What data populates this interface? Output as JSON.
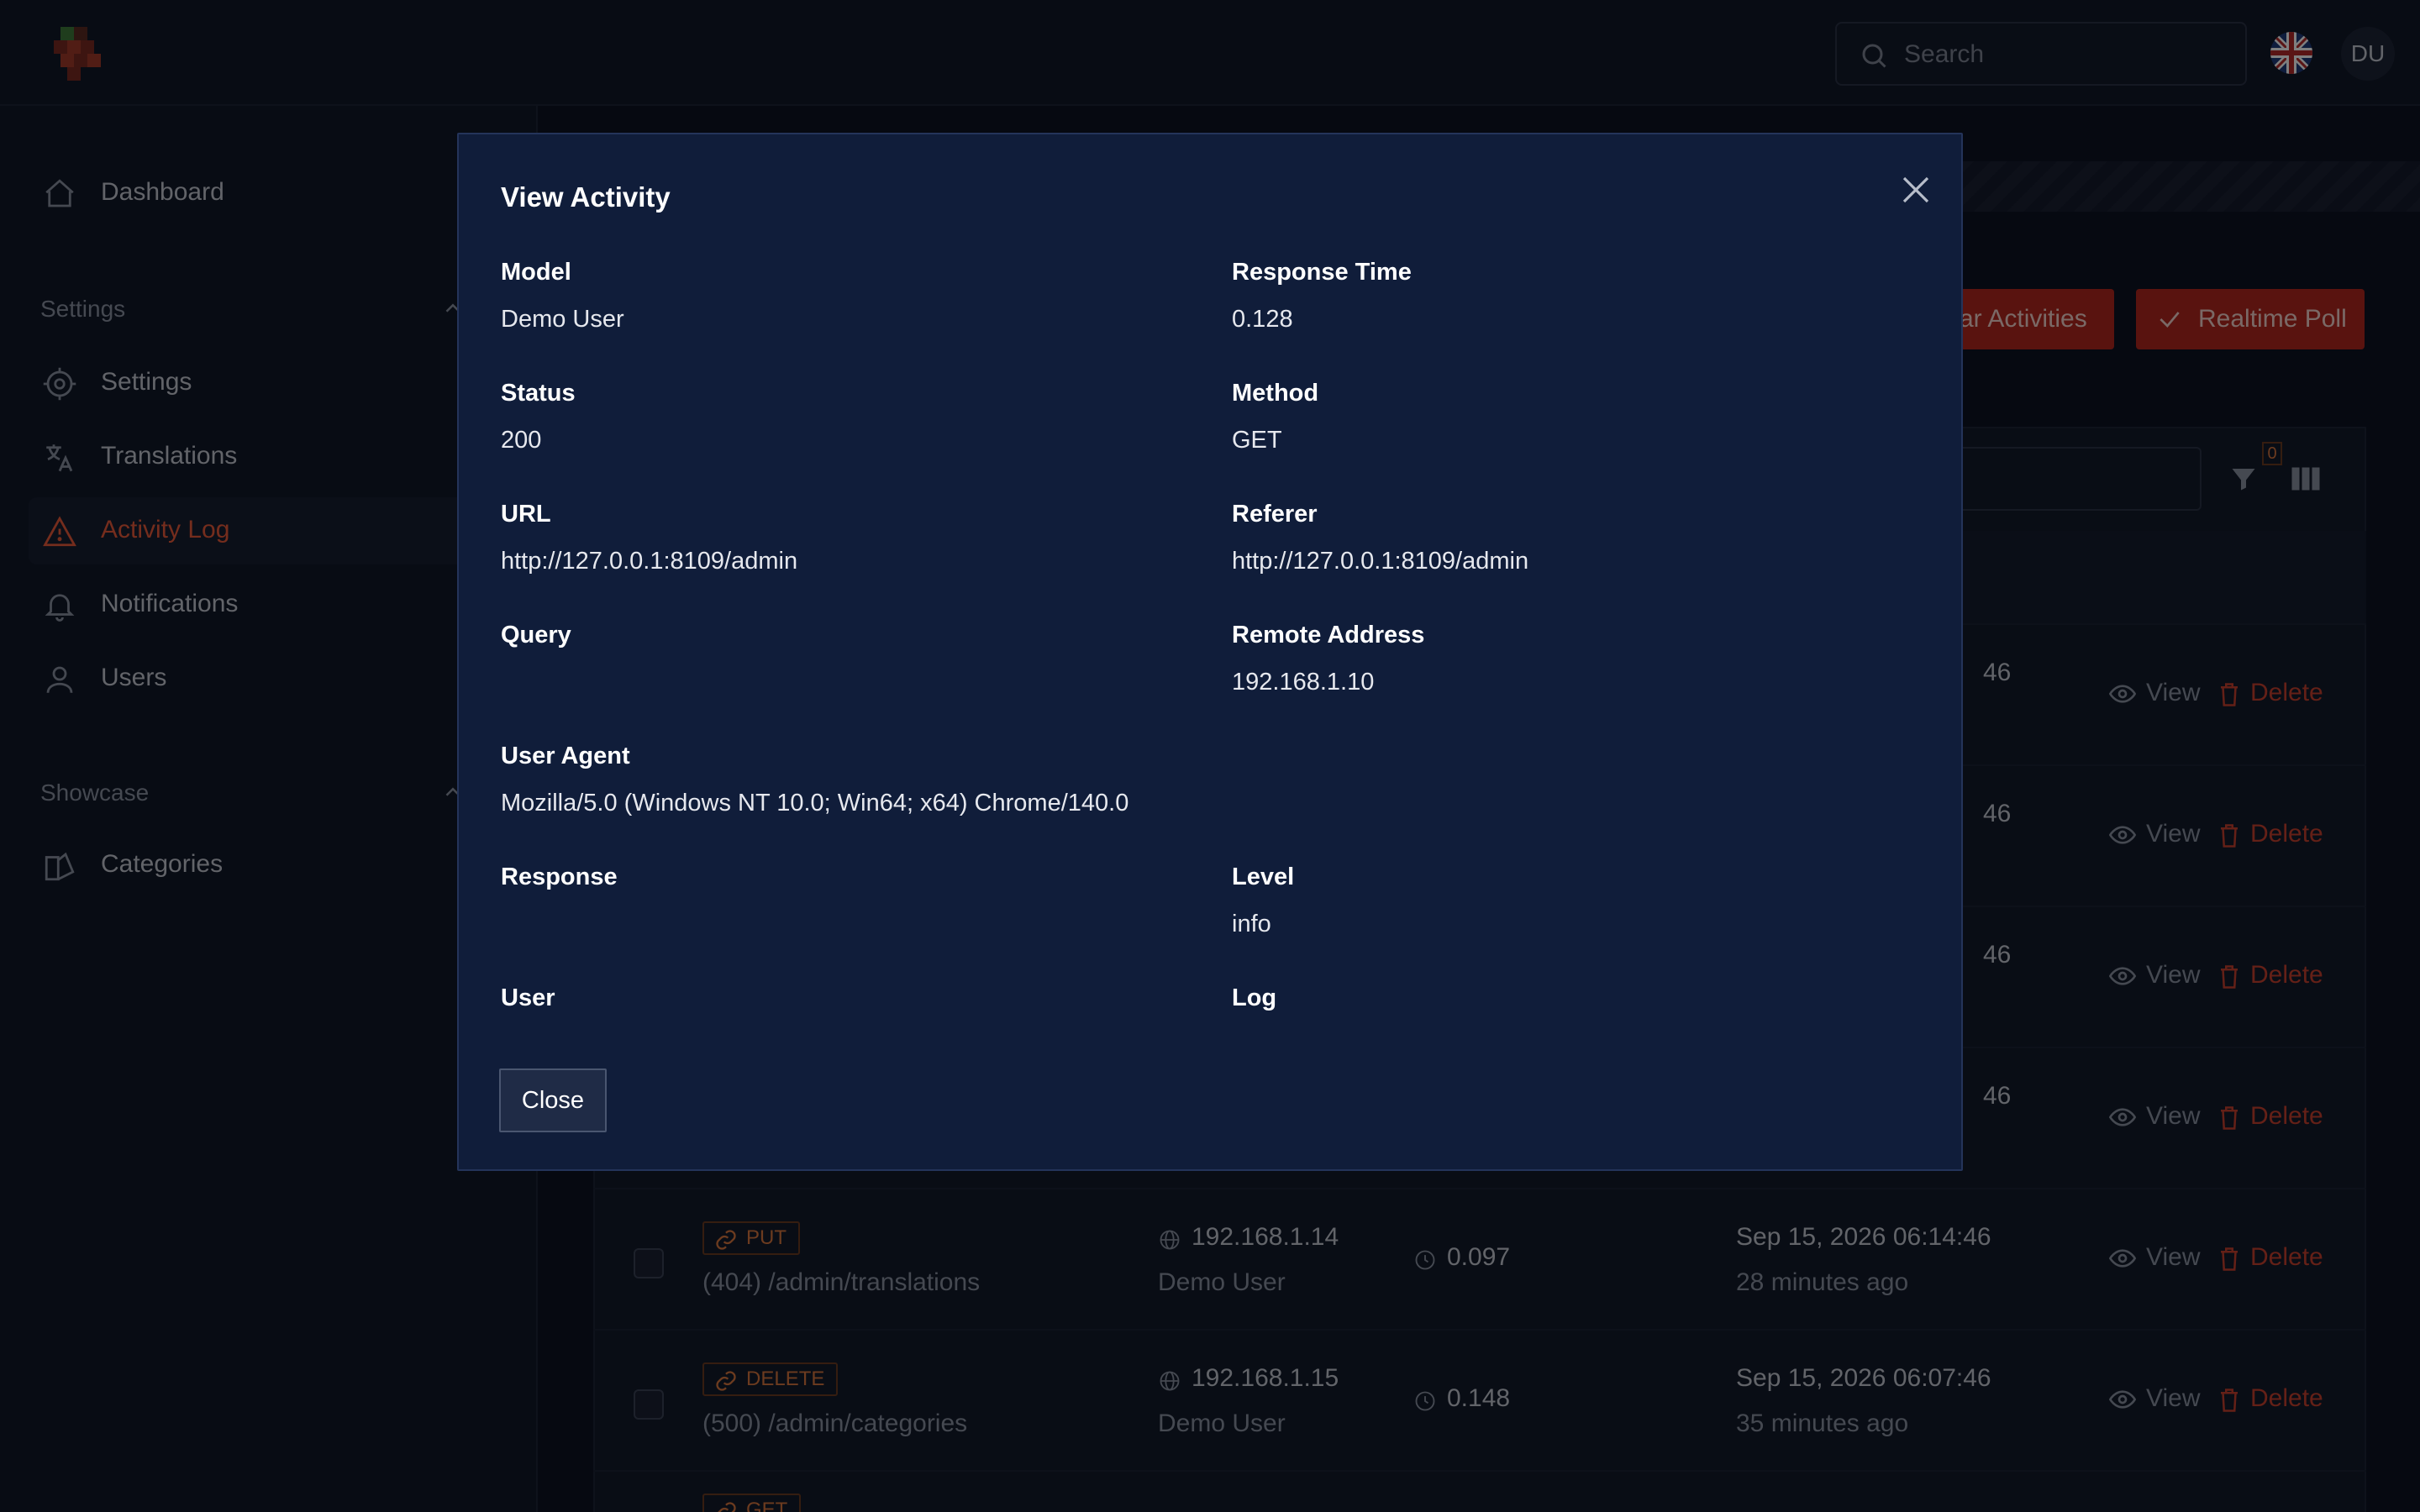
{
  "app": {
    "search_placeholder": "Search",
    "avatar_initials": "DU",
    "language_flag": "uk-flag-icon"
  },
  "sidebar": {
    "dashboard": "Dashboard",
    "settings_section": "Settings",
    "items": [
      {
        "label": "Settings",
        "icon": "gear-icon"
      },
      {
        "label": "Translations",
        "icon": "translate-icon"
      },
      {
        "label": "Activity Log",
        "icon": "warning-icon"
      },
      {
        "label": "Notifications",
        "icon": "bell-icon"
      },
      {
        "label": "Users",
        "icon": "user-icon"
      }
    ],
    "showcase_section": "Showcase",
    "categories": "Categories"
  },
  "toolbar": {
    "clear_label": "ar Activities",
    "realtime_label": "Realtime Poll",
    "filter_count": "0"
  },
  "rows": [
    {
      "date_partial": "46",
      "view": "View",
      "delete": "Delete"
    },
    {
      "date_partial": "46",
      "view": "View",
      "delete": "Delete"
    },
    {
      "date_partial": "46",
      "view": "View",
      "delete": "Delete"
    },
    {
      "date_partial": "46",
      "view": "View",
      "delete": "Delete"
    },
    {
      "method": "PUT",
      "path": "(404) /admin/translations",
      "ip": "192.168.1.14",
      "user": "Demo User",
      "time": "0.097",
      "date": "Sep 15, 2026 06:14:46",
      "ago": "28 minutes ago",
      "view": "View",
      "delete": "Delete"
    },
    {
      "method": "DELETE",
      "path": "(500) /admin/categories",
      "ip": "192.168.1.15",
      "user": "Demo User",
      "time": "0.148",
      "date": "Sep 15, 2026 06:07:46",
      "ago": "35 minutes ago",
      "view": "View",
      "delete": "Delete"
    },
    {
      "method": "GET"
    }
  ],
  "modal": {
    "title": "View Activity",
    "fields": {
      "model": {
        "label": "Model",
        "value": "Demo User"
      },
      "response_time": {
        "label": "Response Time",
        "value": "0.128"
      },
      "status": {
        "label": "Status",
        "value": "200"
      },
      "method": {
        "label": "Method",
        "value": "GET"
      },
      "url": {
        "label": "URL",
        "value": "http://127.0.0.1:8109/admin"
      },
      "referer": {
        "label": "Referer",
        "value": "http://127.0.0.1:8109/admin"
      },
      "query": {
        "label": "Query",
        "value": ""
      },
      "remote_address": {
        "label": "Remote Address",
        "value": "192.168.1.10"
      },
      "user_agent": {
        "label": "User Agent",
        "value": "Mozilla/5.0 (Windows NT 10.0; Win64; x64) Chrome/140.0"
      },
      "response": {
        "label": "Response",
        "value": ""
      },
      "level": {
        "label": "Level",
        "value": "info"
      },
      "user": {
        "label": "User",
        "value": ""
      },
      "log": {
        "label": "Log",
        "value": ""
      }
    },
    "close_label": "Close"
  }
}
